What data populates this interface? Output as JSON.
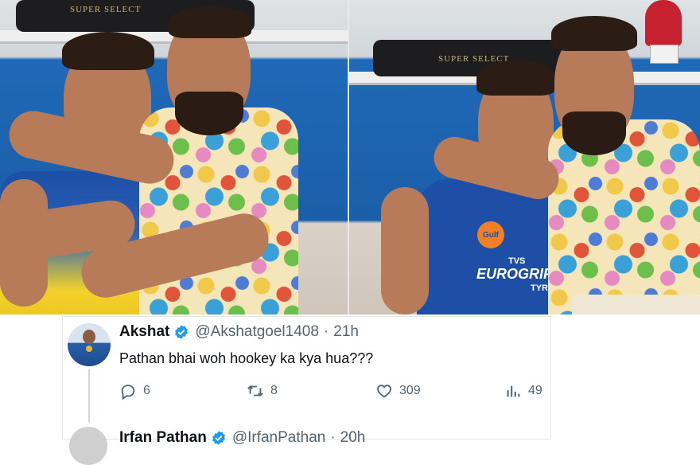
{
  "photos": {
    "left": {
      "bag_label": "SUPER SELECT"
    },
    "right": {
      "bag_label": "SUPER SELECT",
      "jersey_sponsor_top": "Gulf",
      "jersey_sponsor_line1": "TVS",
      "jersey_sponsor_line2": "EUROGRIP",
      "jersey_sponsor_line3": "TYRES"
    }
  },
  "tweets": [
    {
      "name": "Akshat",
      "handle": "@Akshatgoel1408",
      "separator": "·",
      "time": "21h",
      "text": "Pathan bhai woh hookey ka kya hua???",
      "replies": "6",
      "retweets": "8",
      "likes": "309",
      "views": "49",
      "verified": true
    },
    {
      "name": "Irfan Pathan",
      "handle": "@IrfanPathan",
      "separator": "·",
      "time": "20h",
      "verified": true
    }
  ],
  "icons": {
    "reply": "reply-icon",
    "retweet": "retweet-icon",
    "like": "heart-icon",
    "views": "views-chart-icon",
    "verified": "verified-badge-icon"
  },
  "colors": {
    "verified": "#1d9bf0",
    "text_primary": "#0f1419",
    "text_secondary": "#536471",
    "jersey_blue": "#1d4fa6",
    "jersey_yellow": "#f2d22b"
  }
}
